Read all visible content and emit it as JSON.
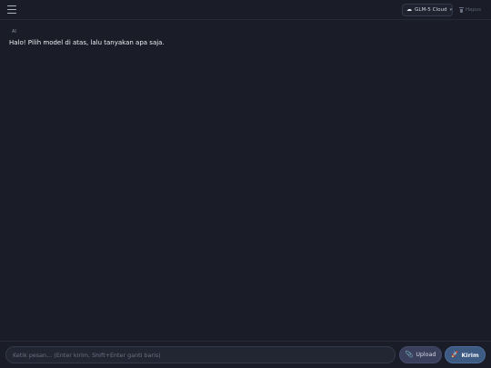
{
  "header": {
    "model_select": {
      "icon": "cloud-icon",
      "value": "GLM-5 Cloud"
    },
    "clear_label": "Hapus"
  },
  "chat": {
    "messages": [
      {
        "role": "AI",
        "text": "Halo! Pilih model di atas, lalu tanyakan apa saja."
      }
    ]
  },
  "composer": {
    "placeholder": "Ketik pesan... (Enter kirim, Shift+Enter ganti baris)",
    "upload_label": "Upload",
    "send_label": "Kirim"
  },
  "colors": {
    "background": "#1a1d27",
    "upload_button": "#3a3f5c",
    "send_button": "#3d5a82"
  }
}
